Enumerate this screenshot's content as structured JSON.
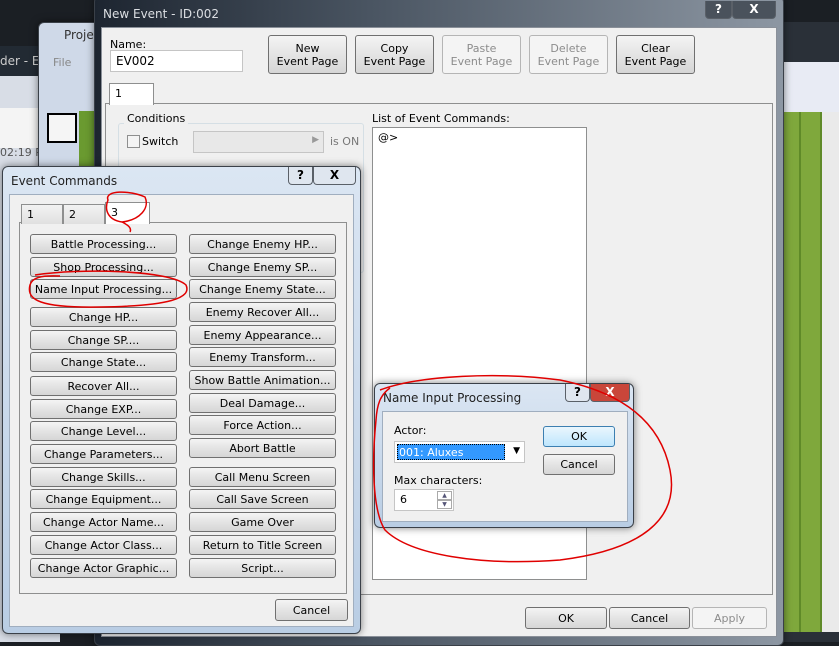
{
  "background": {
    "left_window_title_fragment": "der - Er",
    "left_window_time": "02:19 P",
    "project_window_title_fragment": "Proje",
    "project_menu_file": "File",
    "project_menu_next": "E"
  },
  "event_window": {
    "title": "New Event - ID:002",
    "help": "?",
    "close": "X",
    "name_label": "Name:",
    "name_value": "EV002",
    "buttons": [
      {
        "label": "New\nEvent Page",
        "enabled": true
      },
      {
        "label": "Copy\nEvent Page",
        "enabled": true
      },
      {
        "label": "Paste\nEvent Page",
        "enabled": false
      },
      {
        "label": "Delete\nEvent Page",
        "enabled": false
      },
      {
        "label": "Clear\nEvent Page",
        "enabled": true
      }
    ],
    "page_tab": "1",
    "conditions_label": "Conditions",
    "switch_label": "Switch",
    "switch_suffix": "is ON",
    "list_label": "List of Event Commands:",
    "list_items": [
      "@>"
    ],
    "ok": "OK",
    "cancel": "Cancel",
    "apply": "Apply"
  },
  "event_commands": {
    "title": "Event Commands",
    "help": "?",
    "close": "X",
    "tabs": [
      "1",
      "2",
      "3"
    ],
    "active_tab": "3",
    "left": [
      "Battle Processing...",
      "Shop Processing...",
      "Name Input Processing...",
      "Change HP...",
      "Change SP....",
      "Change State...",
      "Recover All...",
      "Change EXP...",
      "Change Level...",
      "Change Parameters...",
      "Change Skills...",
      "Change Equipment...",
      "Change Actor Name...",
      "Change Actor Class...",
      "Change Actor Graphic..."
    ],
    "right": [
      "Change Enemy HP...",
      "Change Enemy SP...",
      "Change Enemy State...",
      "Enemy Recover All...",
      "Enemy Appearance...",
      "Enemy Transform...",
      "Show Battle Animation...",
      "Deal Damage...",
      "Force Action...",
      "Abort Battle",
      "Call Menu Screen",
      "Call Save Screen",
      "Game Over",
      "Return to Title Screen",
      "Script..."
    ],
    "cancel": "Cancel"
  },
  "name_input": {
    "title": "Name Input Processing",
    "help": "?",
    "close": "X",
    "actor_label": "Actor:",
    "actor_value": "001: Aluxes",
    "max_label": "Max characters:",
    "max_value": "6",
    "ok": "OK",
    "cancel": "Cancel"
  },
  "annotation_color": "#e00000"
}
